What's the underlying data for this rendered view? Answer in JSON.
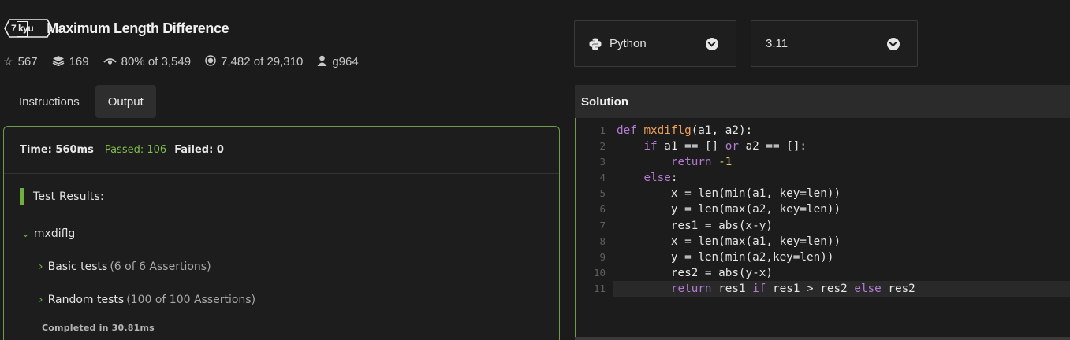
{
  "kata": {
    "rank": "7 kyu",
    "title": "Maximum Length Difference",
    "stats": {
      "stars": "567",
      "collections": "169",
      "satisfaction": "80%",
      "satisfaction_of": "of 3,549",
      "completed": "7,482",
      "completed_of": "of 29,310",
      "author": "g964"
    }
  },
  "tabs": [
    {
      "label": "Instructions",
      "active": false
    },
    {
      "label": "Output",
      "active": true
    }
  ],
  "output": {
    "time": "Time: 560ms",
    "passed": "Passed: 106",
    "failed": "Failed: 0",
    "test_results_label": "Test Results:",
    "suite": "mxdiflg",
    "cases": [
      {
        "name": "Basic tests",
        "detail": "(6 of 6 Assertions)"
      },
      {
        "name": "Random tests",
        "detail": "(100 of 100 Assertions)"
      }
    ],
    "completed": "Completed in 30.81ms"
  },
  "language_select": {
    "value": "Python",
    "icon": "python-icon"
  },
  "version_select": {
    "value": "3.11"
  },
  "solution": {
    "label": "Solution",
    "line_numbers": [
      "1",
      "2",
      "3",
      "4",
      "5",
      "6",
      "7",
      "8",
      "9",
      "10",
      "11"
    ],
    "code": [
      "def mxdiflg(a1, a2):",
      "    if a1 == [] or a2 == []:",
      "        return -1",
      "    else:",
      "        x = len(min(a1, key=len))",
      "        y = len(max(a2, key=len))",
      "        res1 = abs(x-y)",
      "        x = len(max(a1, key=len))",
      "        y = len(min(a2,key=len))",
      "        res2 = abs(y-x)",
      "        return res1 if res1 > res2 else res2"
    ]
  },
  "colors": {
    "accent_green": "#6fb040",
    "border_green": "#6f9a4b",
    "passed": "#7fbf4c"
  }
}
